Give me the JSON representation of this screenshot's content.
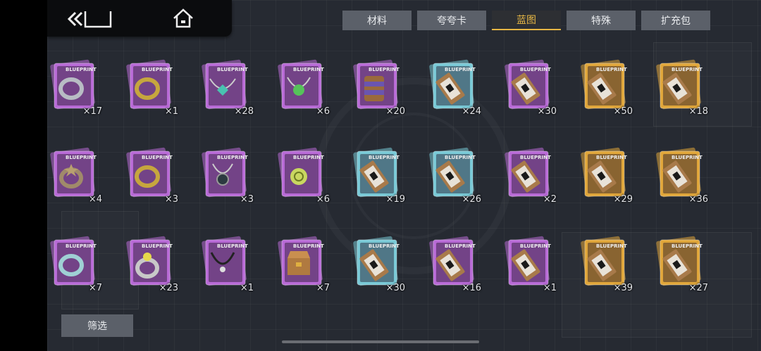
{
  "tabs": [
    "材料",
    "夸夸卡",
    "蓝图",
    "特殊",
    "扩充包"
  ],
  "active_tab": "蓝图",
  "card_label": "BLUEPRINT",
  "filter_label": "筛选",
  "colors": {
    "purple": "#b86ad6",
    "cyan": "#79c9d6",
    "gold": "#e0a63a",
    "accent": "#e7b744"
  },
  "items": [
    {
      "rarity": "purple",
      "content": "ring-silver",
      "count": "×17"
    },
    {
      "rarity": "purple",
      "content": "ring-gold",
      "count": "×1"
    },
    {
      "rarity": "purple",
      "content": "gem-necklace-teal",
      "count": "×28"
    },
    {
      "rarity": "purple",
      "content": "gem-necklace-green",
      "count": "×6"
    },
    {
      "rarity": "purple",
      "content": "chest-armor",
      "count": "×20"
    },
    {
      "rarity": "cyan",
      "content": "ticket",
      "count": "×24"
    },
    {
      "rarity": "purple",
      "content": "ticket",
      "count": "×30"
    },
    {
      "rarity": "gold",
      "content": "ticket",
      "count": "×50"
    },
    {
      "rarity": "gold",
      "content": "ticket",
      "count": "×18"
    },
    {
      "rarity": "purple",
      "content": "ring-star",
      "count": "×4"
    },
    {
      "rarity": "purple",
      "content": "ring-gold-band",
      "count": "×3"
    },
    {
      "rarity": "purple",
      "content": "amulet-dark",
      "count": "×3"
    },
    {
      "rarity": "purple",
      "content": "spiral-pendant",
      "count": "×6"
    },
    {
      "rarity": "cyan",
      "content": "ticket",
      "count": "×19"
    },
    {
      "rarity": "cyan",
      "content": "ticket",
      "count": "×26"
    },
    {
      "rarity": "purple",
      "content": "ticket",
      "count": "×2"
    },
    {
      "rarity": "gold",
      "content": "ticket",
      "count": "×29"
    },
    {
      "rarity": "gold",
      "content": "ticket",
      "count": "×36"
    },
    {
      "rarity": "purple",
      "content": "ring-cyan",
      "count": "×7"
    },
    {
      "rarity": "purple",
      "content": "ring-gem-yellow",
      "count": "×23"
    },
    {
      "rarity": "purple",
      "content": "necklace-black",
      "count": "×1"
    },
    {
      "rarity": "purple",
      "content": "treasure-chest",
      "count": "×7"
    },
    {
      "rarity": "cyan",
      "content": "ticket",
      "count": "×30"
    },
    {
      "rarity": "purple",
      "content": "ticket",
      "count": "×16"
    },
    {
      "rarity": "purple",
      "content": "ticket",
      "count": "×1"
    },
    {
      "rarity": "gold",
      "content": "ticket",
      "count": "×39"
    },
    {
      "rarity": "gold",
      "content": "ticket",
      "count": "×27"
    }
  ]
}
